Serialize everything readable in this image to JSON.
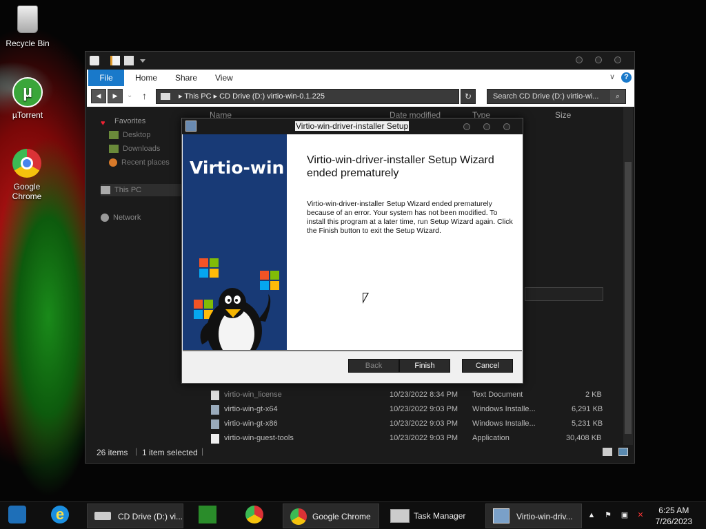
{
  "desktop": {
    "icons": [
      {
        "label": "Recycle Bin",
        "icon": "recycle-bin-icon"
      },
      {
        "label": "µTorrent",
        "icon": "utorrent-icon"
      },
      {
        "label": "Google Chrome",
        "icon": "chrome-icon"
      }
    ]
  },
  "explorer": {
    "ribbon_tabs": [
      "File",
      "Home",
      "Share",
      "View"
    ],
    "help_label": "?",
    "breadcrumb": [
      "This PC",
      "CD Drive (D:) virtio-win-0.1.225"
    ],
    "search_placeholder": "Search CD Drive (D:) virtio-wi...",
    "nav": {
      "favorites": "Favorites",
      "desktop": "Desktop",
      "downloads": "Downloads",
      "recent": "Recent places",
      "this_pc": "This PC",
      "network": "Network"
    },
    "columns": {
      "name": "Name",
      "date": "Date modified",
      "type": "Type",
      "size": "Size"
    },
    "files": [
      {
        "name": "virtio-win_license",
        "date": "10/23/2022 8:34 PM",
        "type": "Text Document",
        "size": "2 KB"
      },
      {
        "name": "virtio-win-gt-x64",
        "date": "10/23/2022 9:03 PM",
        "type": "Windows Installe...",
        "size": "6,291 KB"
      },
      {
        "name": "virtio-win-gt-x86",
        "date": "10/23/2022 9:03 PM",
        "type": "Windows Installe...",
        "size": "5,231 KB"
      },
      {
        "name": "virtio-win-guest-tools",
        "date": "10/23/2022 9:03 PM",
        "type": "Application",
        "size": "30,408 KB"
      }
    ],
    "status": {
      "count": "26 items",
      "selected": "1 item selected"
    }
  },
  "dialog": {
    "title": "Virtio-win-driver-installer Setup",
    "brand": "Virtio-win",
    "heading": "Virtio-win-driver-installer Setup Wizard ended prematurely",
    "body": "Virtio-win-driver-installer Setup Wizard ended prematurely because of an error. Your system has not been modified. To install this program at a later time, run Setup Wizard again. Click the Finish button to exit the Setup Wizard.",
    "buttons": {
      "back": "Back",
      "finish": "Finish",
      "cancel": "Cancel"
    }
  },
  "taskbar": {
    "items": [
      {
        "label": "CD Drive (D:) vi...",
        "icon": "drive-icon"
      },
      {
        "label": "Google Chrome",
        "icon": "chrome-icon"
      },
      {
        "label": "Task Manager",
        "icon": "task-manager-icon"
      },
      {
        "label": "Virtio-win-driv...",
        "icon": "installer-icon"
      }
    ],
    "time": "6:25 AM",
    "date": "7/26/2023"
  }
}
